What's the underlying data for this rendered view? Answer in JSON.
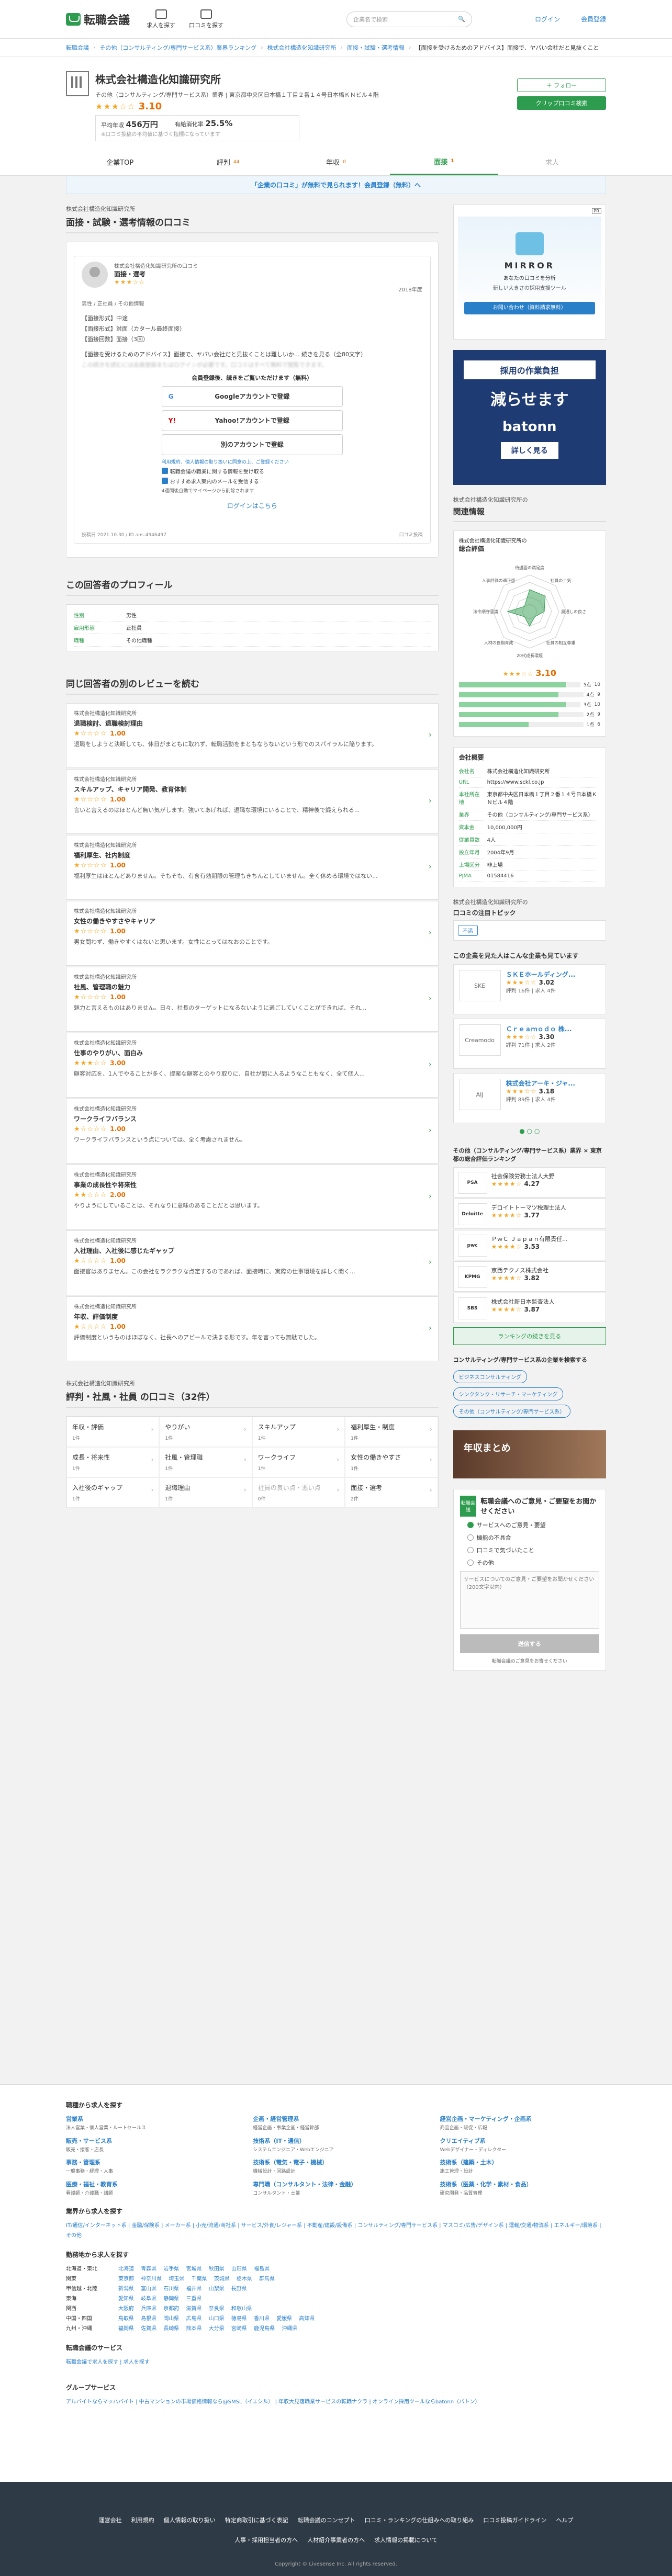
{
  "brand": {
    "name": "転職会議",
    "sub": "",
    "nav": [
      "求人を探す",
      "口コミを探す"
    ],
    "search_placeholder": "企業名で検索",
    "login": "ログイン",
    "register": "会員登録",
    "accent": "#2e9c4e"
  },
  "breadcrumb": [
    "転職会議",
    "その他（コンサルティング/専門サービス系）業界ランキング",
    "株式会社構造化知識研究所",
    "面接・試験・選考情報",
    "【面接を受けるためのアドバイス】面接で、ヤバい会社だと見抜くこと"
  ],
  "company": {
    "name": "株式会社構造化知識研究所",
    "meta": "その他（コンサルティング/専門サービス系）業界 | 東京都中央区日本橋１丁目２番１４号日本橋ＫＮビル４階",
    "score": "3.10",
    "stars": "★★★☆☆",
    "avg_salary_label": "平均年収",
    "avg_salary": "456万円",
    "answer_label": "有給消化率",
    "answer": "25.5%",
    "stat_note": "※口コミ投稿の平均値に基づく指標になっています",
    "follow": "＋ フォロー",
    "clip": "クリップ口コミ検索"
  },
  "tabs": [
    {
      "label": "企業TOP",
      "count": ""
    },
    {
      "label": "評判",
      "count": "44"
    },
    {
      "label": "年収",
      "count": "0"
    },
    {
      "label": "面接",
      "count": "1"
    },
    {
      "label": "求人",
      "count": ""
    }
  ],
  "notice": "「企業の口コミ」が無料で見られます！会員登録（無料）へ",
  "review": {
    "sub": "株式会社構造化知識研究所",
    "title": "面接・試験・選考情報の口コミ",
    "company": "株式会社構造化知識研究所の口コミ",
    "cat": "面接・選考",
    "stars": "★★★☆☆",
    "date": "2018年度",
    "attrs": "男性 / 正社員 / その他情報",
    "lines": [
      "【面接形式】中途",
      "【面接形式】対面（カタール最終面接）",
      "【面接回数】面接（3回）"
    ],
    "body": "【面接を受けるためのアドバイス】面接で、ヤバい会社だと見抜くことは難しいか... 続きを見る（全80文字）",
    "blurred": "この続きを読むには会員登録またはログインが必要です。口コミはすべて無料で閲覧できます。",
    "unlock_title": "会員登録後、続きをご覧いただけます（無料）",
    "google": "Googleアカウントで登録",
    "yahoo": "Yahoo!アカウントで登録",
    "other": "別のアカウントで登録",
    "agree": "利用規約、個人情報の取り扱いに同意の上、ご登録ください",
    "c1": "転職会議の職業に関する情報を受け取る",
    "c2": "おすすめ求人案内のメールを受信する",
    "fine": "4週間後自動でマイページから削除されます",
    "login": "ログインはこちら",
    "footL": "投稿日 2021.10.30 / ID ans-4946497",
    "footR": "口コミ投稿"
  },
  "profile": {
    "title": "この回答者のプロフィール",
    "rows": [
      {
        "k": "性別",
        "v": "男性"
      },
      {
        "k": "雇用形態",
        "v": "正社員"
      },
      {
        "k": "職種",
        "v": "その他職種"
      }
    ]
  },
  "others": {
    "title": "同じ回答者の別のレビューを読む",
    "items": [
      {
        "s": "株式会社構造化知識研究所",
        "t": "退職検討、退職検討理由",
        "sc": "1.00",
        "stars": "★☆☆☆☆",
        "tx": "退職をしようと決断しても、休日がまともに取れず、転職活動をまともならないという形でのスパイラルに陥ります。"
      },
      {
        "s": "株式会社構造化知識研究所",
        "t": "スキルアップ、キャリア開発、教育体制",
        "sc": "1.00",
        "stars": "★☆☆☆☆",
        "tx": "言いと言えるのはほとんど無い気がします。強いてあげれば、退職な環境にいることで、精神後で鍛えられる..."
      },
      {
        "s": "株式会社構造化知識研究所",
        "t": "福利厚生、社内制度",
        "sc": "1.00",
        "stars": "★☆☆☆☆",
        "tx": "福利厚生はほとんどありません。そもそも、有含有効期限の管理もきちんとしていません。全く休める環境ではない..."
      },
      {
        "s": "株式会社構造化知識研究所",
        "t": "女性の働きやすさやキャリア",
        "sc": "1.00",
        "stars": "★☆☆☆☆",
        "tx": "男女問わず、働きやすくはないと思います。女性にとってはなおのことです。"
      },
      {
        "s": "株式会社構造化知識研究所",
        "t": "社風、管理職の魅力",
        "sc": "1.00",
        "stars": "★☆☆☆☆",
        "tx": "魅力と言えるものはありません。日々、社長のターゲットになるないように過ごしていくことができれば、それ..."
      },
      {
        "s": "株式会社構造化知識研究所",
        "t": "仕事のやりがい、面白み",
        "sc": "3.00",
        "stars": "★★★☆☆",
        "tx": "顧客対応を、1人でやることが多く、提案な顧客とのやり取りに、自社が間に入るようなこともなく、全て個人..."
      },
      {
        "s": "株式会社構造化知識研究所",
        "t": "ワークライフバランス",
        "sc": "1.00",
        "stars": "★☆☆☆☆",
        "tx": "ワークライフバランスという点については、全く考慮されません。"
      },
      {
        "s": "株式会社構造化知識研究所",
        "t": "事業の成長性や将来性",
        "sc": "2.00",
        "stars": "★★☆☆☆",
        "tx": "やりようにしていることは、それなりに意味のあることだとは思います。"
      },
      {
        "s": "株式会社構造化知識研究所",
        "t": "入社理由、入社後に感じたギャップ",
        "sc": "1.00",
        "stars": "★☆☆☆☆",
        "tx": "面接官はありません。この会社をラクラクな点定するのであれば、面接時に、実際の仕事環境を詳しく聞く..."
      },
      {
        "s": "株式会社構造化知識研究所",
        "t": "年収、評価制度",
        "sc": "1.00",
        "stars": "★☆☆☆☆",
        "tx": "評価制度というものはほぼなく、社長へのアピールで決まる形です。年を言っても無駄でした。"
      }
    ]
  },
  "cats": {
    "sub": "株式会社構造化知識研究所",
    "title": "評判・社風・社員 の口コミ（32件）",
    "items": [
      {
        "n": "年収・評価",
        "c": "1件"
      },
      {
        "n": "やりがい",
        "c": "1件"
      },
      {
        "n": "スキルアップ",
        "c": "1件"
      },
      {
        "n": "福利厚生・制度",
        "c": "1件"
      },
      {
        "n": "成長・将来性",
        "c": "1件"
      },
      {
        "n": "社風・管理職",
        "c": "1件"
      },
      {
        "n": "ワークライフ",
        "c": "1件"
      },
      {
        "n": "女性の働きやすさ",
        "c": "1件"
      },
      {
        "n": "入社後のギャップ",
        "c": "1件"
      },
      {
        "n": "退職理由",
        "c": "1件"
      },
      {
        "n": "社員の良い点・悪い点",
        "c": "0件"
      },
      {
        "n": "面接・選考",
        "c": "2件"
      }
    ]
  },
  "side": {
    "ad1_tag": "PR",
    "ad1_title": "MIRROR",
    "ad1_sub": "あなたの口コミを分析",
    "ad1_desc": "新しい大きさの採用支援ツール",
    "ad1_btn": "お問い合わせ（資料請求無料）",
    "ad2_top": "採用の作業負担",
    "ad2_mid": "減らせます",
    "ad2_brand": "batonn",
    "ad2_btn": "詳しく見る",
    "eval_sub": "株式会社構造化知識研究所の",
    "eval_title": "関連情報",
    "eval_label": "総合評価",
    "radar_labels": [
      "待遇面の満足度",
      "社員の士気",
      "風通しの良さ",
      "社員の相互尊重",
      "20代成長環境",
      "人材の長期育成",
      "法令順守意識",
      "人事評価の適正感"
    ],
    "radar_values": [
      3,
      3,
      2,
      1,
      2,
      1,
      3,
      1
    ],
    "eval_score": "3.10",
    "bars": [
      {
        "k": "5点",
        "v": "10"
      },
      {
        "k": "4点",
        "v": "9"
      },
      {
        "k": "3点",
        "v": "10"
      },
      {
        "k": "2点",
        "v": "9"
      },
      {
        "k": "1点",
        "v": "6"
      }
    ],
    "bar_values": [
      0.22,
      0.2,
      0.22,
      0.2,
      0.14
    ],
    "info_title": "会社概要",
    "info": [
      {
        "k": "会社名",
        "v": "株式会社構造化知識研究所"
      },
      {
        "k": "URL",
        "v": "https://www.sckl.co.jp"
      },
      {
        "k": "本社所在地",
        "v": "東京都中央区日本橋１丁目２番１４号日本橋ＫＮビル４階"
      },
      {
        "k": "業界",
        "v": "その他（コンサルティング/専門サービス系）"
      },
      {
        "k": "資本金",
        "v": "10,000,000円"
      },
      {
        "k": "従業員数",
        "v": "4人"
      },
      {
        "k": "設立年月",
        "v": "2004年9月"
      },
      {
        "k": "上場区分",
        "v": "非上場"
      },
      {
        "k": "PJMA",
        "v": "01584416"
      }
    ],
    "topic_sub": "株式会社構造化知識研究所の",
    "topic_title": "口コミの注目トピック",
    "topic_tag": "不満",
    "sim_title": "この企業を見た人はこんな企業も見ています",
    "sim": [
      {
        "lo": "SKE",
        "nm": "ＳＫＥホールディング...",
        "sc": "3.02",
        "stars": "★★★☆☆",
        "sd": "評判 16件 | 求人 4件"
      },
      {
        "lo": "Creamodo",
        "nm": "Ｃｒｅａｍｏｄｏ 株...",
        "sc": "3.30",
        "stars": "★★★☆☆",
        "sd": "評判 71件 | 求人 2件"
      },
      {
        "lo": "AIJ",
        "nm": "株式会社アーキ・ジャ...",
        "sc": "3.18",
        "stars": "★★★☆☆",
        "sd": "評判 89件 | 求人 4件"
      }
    ],
    "rank_title": "その他（コンサルティング/専門サービス系）業界 × 東京都の総合評価ランキング",
    "rank": [
      {
        "lo": "PSA",
        "nm": "社会保険労務士法人大野",
        "sc": "4.27"
      },
      {
        "lo": "Deloitte",
        "nm": "デロイトトーマツ税理士法人",
        "sc": "3.77"
      },
      {
        "lo": "pwc",
        "nm": "ＰｗＣ Ｊａｐａｎ有限責任...",
        "sc": "3.53"
      },
      {
        "lo": "KPMG",
        "nm": "京西テクノス株式会社",
        "sc": "3.82"
      },
      {
        "lo": "SBS",
        "nm": "株式会社新日本監査法人",
        "sc": "3.87"
      }
    ],
    "rank_btn": "ランキングの続きを見る",
    "ind_title": "コンサルティング/専門サービス系の企業を検索する",
    "ind_tags": [
      "ビジネスコンサルティング",
      "シンクタンク・リサーチ・マーケティング",
      "その他（コンサルティング/専門サービス系）"
    ],
    "banner": "年収まとめ",
    "fb_badge": "転職会議",
    "fb_title": "転職会議へのご意見・ご要望をお聞かせください",
    "fb_opts": [
      "サービスへのご意見・要望",
      "機能の不具合",
      "口コミで気づいたこと",
      "その他"
    ],
    "fb_placeholder": "サービスについてのご意見・ご要望をお聞かせください（200文字以内）",
    "fb_submit": "送信する",
    "fb_note": "転職会議のご意見をお寄せください"
  },
  "footer": {
    "jobs_title": "職種から求人を探す",
    "jobs": [
      {
        "h": "営業系",
        "p": "法人営業・個人営業・ルートセールス"
      },
      {
        "h": "企画・経営管理系",
        "p": "経営企画・事業企画・経営幹部"
      },
      {
        "h": "経営企画・マーケティング・企画系",
        "p": "商品企画・販促・広報"
      },
      {
        "h": "販売・サービス系",
        "p": "販売・接客・店長"
      },
      {
        "h": "技術系（IT・通信）",
        "p": "システムエンジニア・Webエンジニア"
      },
      {
        "h": "クリエイティブ系",
        "p": "Webデザイナー・ディレクター"
      },
      {
        "h": "事務・管理系",
        "p": "一般事務・経理・人事"
      },
      {
        "h": "技術系（電気・電子・機械）",
        "p": "機械設計・回路設計"
      },
      {
        "h": "技術系（建築・土木）",
        "p": "施工管理・設計"
      },
      {
        "h": "医療・福祉・教育系",
        "p": "看護師・介護職・講師"
      },
      {
        "h": "専門職（コンサルタント・法律・金融）",
        "p": "コンサルタント・士業"
      },
      {
        "h": "技術系（医薬・化学・素材・食品）",
        "p": "研究開発・品質管理"
      }
    ],
    "ind_title": "業界から求人を探す",
    "ind": "IT/通信/インターネット系 | 金融/保険系 | メーカー系 | 小売/流通/商社系 | サービス/外食/レジャー系 | 不動産/建設/設備系 | コンサルティング/専門サービス系 | マスコミ/広告/デザイン系 | 運輸/交通/物流系 | エネルギー/環境系 | その他",
    "pref_title": "勤務地から求人を探す",
    "prefs": [
      {
        "r": "北海道・東北",
        "l": "北海道 青森県 岩手県 宮城県 秋田県 山形県 福島県"
      },
      {
        "r": "関東",
        "l": "東京都 神奈川県 埼玉県 千葉県 茨城県 栃木県 群馬県"
      },
      {
        "r": "甲信越・北陸",
        "l": "新潟県 富山県 石川県 福井県 山梨県 長野県"
      },
      {
        "r": "東海",
        "l": "愛知県 岐阜県 静岡県 三重県"
      },
      {
        "r": "関西",
        "l": "大阪府 兵庫県 京都府 滋賀県 奈良県 和歌山県"
      },
      {
        "r": "中国・四国",
        "l": "鳥取県 島根県 岡山県 広島県 山口県 徳島県 香川県 愛媛県 高知県"
      },
      {
        "r": "九州・沖縄",
        "l": "福岡県 佐賀県 長崎県 熊本県 大分県 宮崎県 鹿児島県 沖縄県"
      }
    ],
    "svc_title": "転職会議のサービス",
    "svc": "転職会議で求人を探す | 求人を探す",
    "group_title": "グループサービス",
    "group": "アルバイトならマッハバイト | 中古マンションの市場価格情報なら@SMSL（イエシル） | 年収大見落職業サービスの転職ナクラ | オンライン採用ツールならbatonn（バトン）",
    "links": [
      "運営会社",
      "利用規約",
      "個人情報の取り扱い",
      "特定商取引に基づく表記",
      "転職会議のコンセプト",
      "口コミ・ランキングの仕組みへの取り組み",
      "口コミ投稿ガイドライン",
      "ヘルプ",
      "人事・採用担当者の方へ",
      "人材紹介事業者の方へ",
      "求人情報の掲載について"
    ],
    "copyright": "Copyright © Livesense Inc. All rights reserved."
  }
}
